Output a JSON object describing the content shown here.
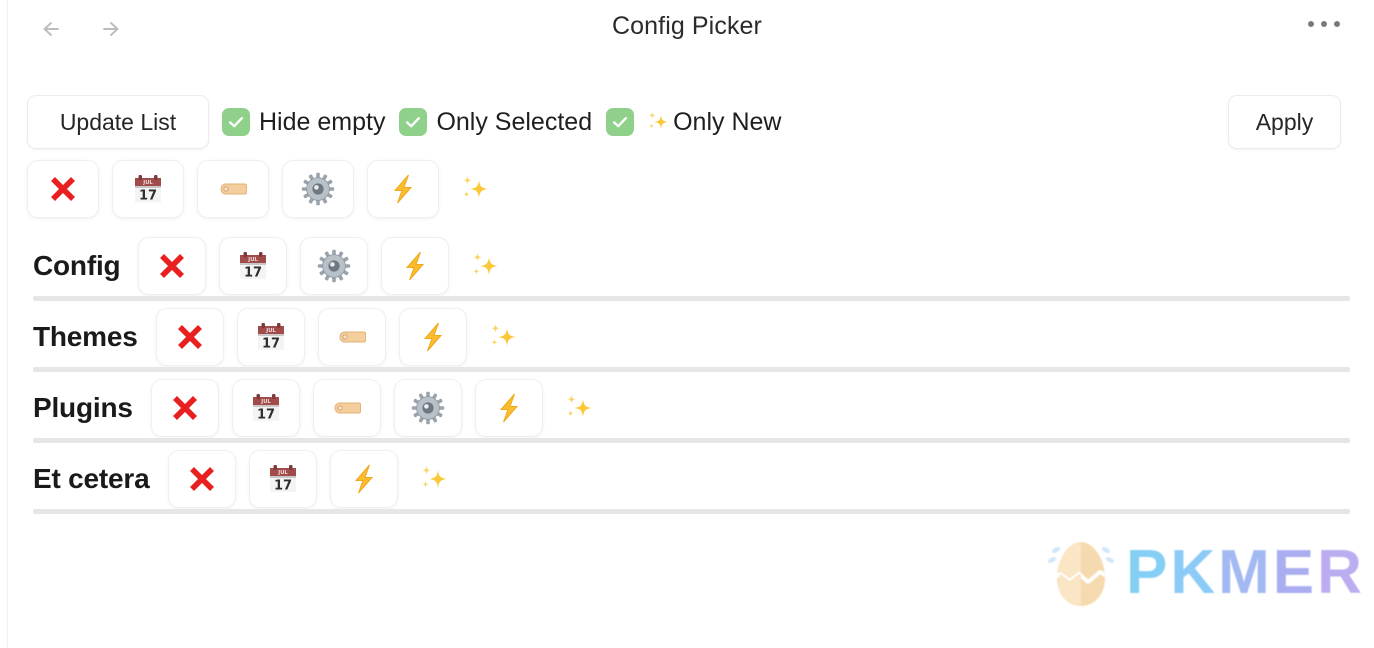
{
  "window": {
    "title": "Config Picker",
    "back_icon": "arrow-left-icon",
    "forward_icon": "arrow-right-icon",
    "more_icon": "ellipsis-icon"
  },
  "toolbar": {
    "update_label": "Update List",
    "apply_label": "Apply",
    "checkboxes": [
      {
        "label": "Hide empty",
        "checked": true,
        "prefix_icon": ""
      },
      {
        "label": "Only Selected",
        "checked": true,
        "prefix_icon": ""
      },
      {
        "label": "Only New",
        "checked": true,
        "prefix_icon": "sparkles-icon"
      }
    ],
    "checkbox_color": "#8fd18a",
    "checkmark_color": "#ffffff"
  },
  "filter_row": {
    "name": "global-filter-icons",
    "icons": [
      {
        "icon": "cross-mark-icon",
        "boxed": true
      },
      {
        "icon": "calendar-icon",
        "boxed": true,
        "calendar_month": "JUL",
        "calendar_day": "17"
      },
      {
        "icon": "tag-icon",
        "boxed": true
      },
      {
        "icon": "gear-icon",
        "boxed": true
      },
      {
        "icon": "lightning-icon",
        "boxed": true
      },
      {
        "icon": "sparkles-icon",
        "boxed": false
      }
    ]
  },
  "list": {
    "rows": [
      {
        "label": "Config",
        "icons": [
          {
            "icon": "cross-mark-icon",
            "boxed": true
          },
          {
            "icon": "calendar-icon",
            "boxed": true,
            "calendar_month": "JUL",
            "calendar_day": "17"
          },
          {
            "icon": "gear-icon",
            "boxed": true
          },
          {
            "icon": "lightning-icon",
            "boxed": true
          },
          {
            "icon": "sparkles-icon",
            "boxed": false
          }
        ]
      },
      {
        "label": "Themes",
        "icons": [
          {
            "icon": "cross-mark-icon",
            "boxed": true
          },
          {
            "icon": "calendar-icon",
            "boxed": true,
            "calendar_month": "JUL",
            "calendar_day": "17"
          },
          {
            "icon": "tag-icon",
            "boxed": true
          },
          {
            "icon": "lightning-icon",
            "boxed": true
          },
          {
            "icon": "sparkles-icon",
            "boxed": false
          }
        ]
      },
      {
        "label": "Plugins",
        "icons": [
          {
            "icon": "cross-mark-icon",
            "boxed": true
          },
          {
            "icon": "calendar-icon",
            "boxed": true,
            "calendar_month": "JUL",
            "calendar_day": "17"
          },
          {
            "icon": "tag-icon",
            "boxed": true
          },
          {
            "icon": "gear-icon",
            "boxed": true
          },
          {
            "icon": "lightning-icon",
            "boxed": true
          },
          {
            "icon": "sparkles-icon",
            "boxed": false
          }
        ]
      },
      {
        "label": "Et cetera",
        "icons": [
          {
            "icon": "cross-mark-icon",
            "boxed": true
          },
          {
            "icon": "calendar-icon",
            "boxed": true,
            "calendar_month": "JUL",
            "calendar_day": "17"
          },
          {
            "icon": "lightning-icon",
            "boxed": true
          },
          {
            "icon": "sparkles-icon",
            "boxed": false
          }
        ]
      }
    ]
  },
  "watermark": {
    "letters": [
      "P",
      "K",
      "M",
      "E",
      "R"
    ],
    "logo_icon": "pkmer-egg-logo"
  }
}
